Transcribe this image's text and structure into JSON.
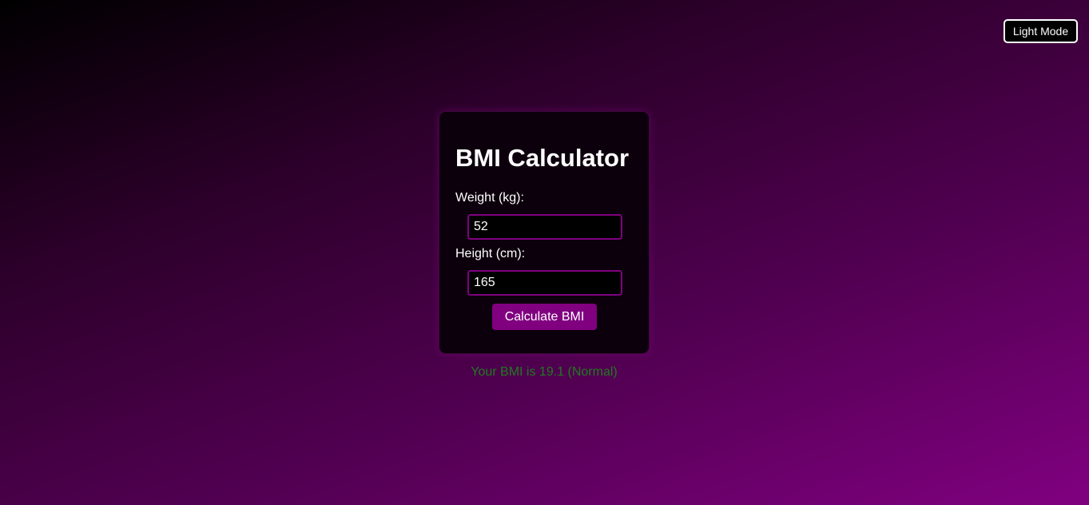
{
  "theme_toggle": {
    "label": "Light Mode"
  },
  "calculator": {
    "title": "BMI Calculator",
    "weight": {
      "label": "Weight (kg):",
      "value": "52"
    },
    "height": {
      "label": "Height (cm):",
      "value": "165"
    },
    "button_label": "Calculate BMI"
  },
  "result": {
    "text": "Your BMI is 19.1 (Normal)",
    "color": "#1f7a1f"
  },
  "colors": {
    "accent": "#800080",
    "card_background": "#0c000c",
    "text": "#ffffff"
  }
}
